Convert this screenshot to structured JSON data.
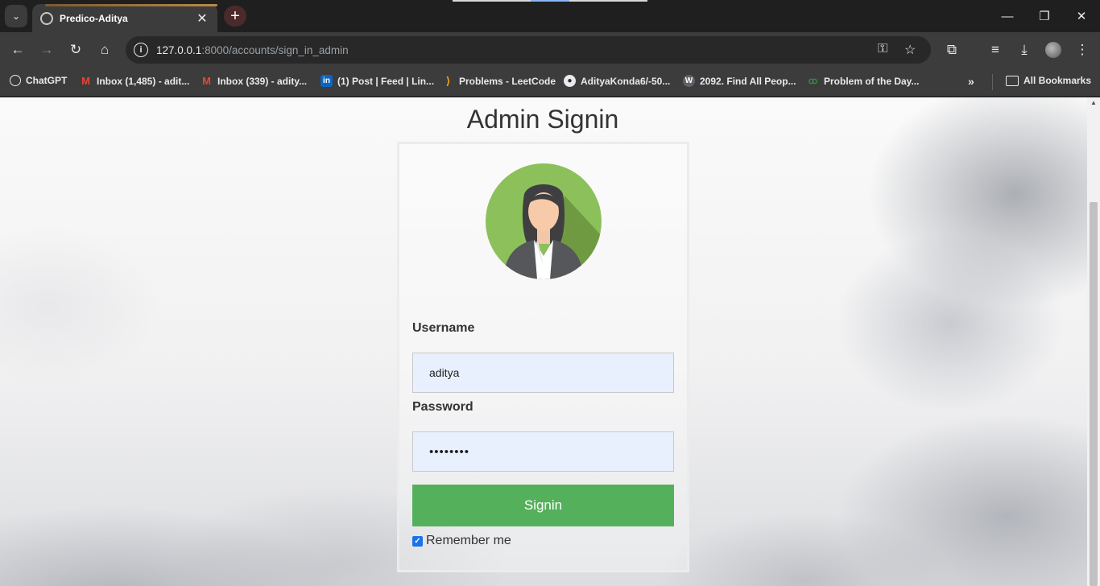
{
  "browser": {
    "tab_title": "Predico-Aditya",
    "url_host": "127.0.0.1",
    "url_path": ":8000/accounts/sign_in_admin"
  },
  "bookmarks": [
    {
      "label": "ChatGPT",
      "icon": "chatgpt-icon"
    },
    {
      "label": "Inbox (1,485) - adit...",
      "icon": "gmail-icon"
    },
    {
      "label": "Inbox (339) - adity...",
      "icon": "gmail-icon"
    },
    {
      "label": "(1) Post | Feed | Lin...",
      "icon": "linkedin-icon"
    },
    {
      "label": "Problems - LeetCode",
      "icon": "leetcode-icon"
    },
    {
      "label": "AdityaKonda6/-50...",
      "icon": "github-icon"
    },
    {
      "label": "2092. Find All Peop...",
      "icon": "w-icon"
    },
    {
      "label": "Problem of the Day...",
      "icon": "gfg-icon"
    }
  ],
  "all_bookmarks_label": "All Bookmarks",
  "page": {
    "title": "Admin Signin",
    "username_label": "Username",
    "username_value": "aditya",
    "password_label": "Password",
    "password_value": "••••••••",
    "signin_label": "Signin",
    "remember_label": "Remember me",
    "remember_checked": true
  },
  "colors": {
    "signin_button": "#55b05c",
    "input_background": "#e8f0fe",
    "avatar_background": "#8cc05b"
  }
}
